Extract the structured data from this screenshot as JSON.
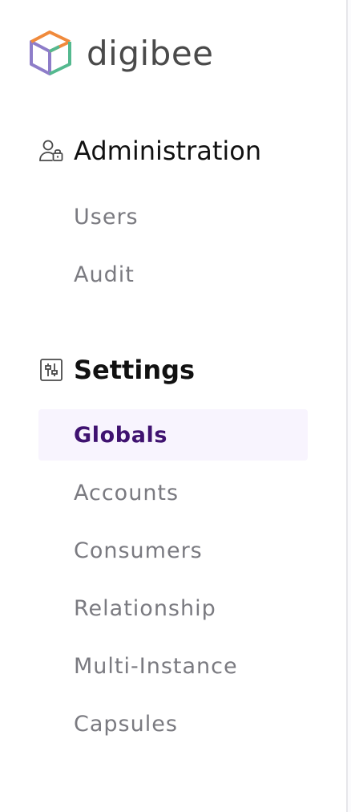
{
  "brand": {
    "name": "digibee",
    "logo_icon": "digibee-cube-logo"
  },
  "sections": [
    {
      "title": "Administration",
      "icon": "user-lock-icon",
      "items": [
        {
          "label": "Users",
          "active": false
        },
        {
          "label": "Audit",
          "active": false
        }
      ]
    },
    {
      "title": "Settings",
      "icon": "sliders-icon",
      "items": [
        {
          "label": "Globals",
          "active": true
        },
        {
          "label": "Accounts",
          "active": false
        },
        {
          "label": "Consumers",
          "active": false
        },
        {
          "label": "Relationship",
          "active": false
        },
        {
          "label": "Multi-Instance",
          "active": false
        },
        {
          "label": "Capsules",
          "active": false
        }
      ]
    }
  ],
  "colors": {
    "active_bg": "#f8f4fe",
    "active_text": "#3f1270",
    "item_text": "#7a7a80",
    "logo_purple": "#8e7dc9",
    "logo_orange": "#f08a3c",
    "logo_green": "#54b98f"
  }
}
